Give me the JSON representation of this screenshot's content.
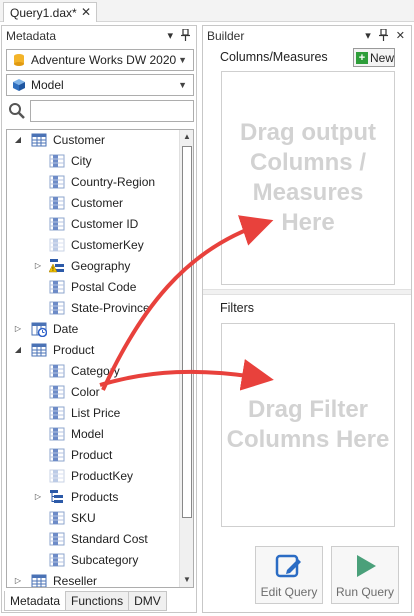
{
  "doc_tab": {
    "title": "Query1.dax*",
    "close": "✕"
  },
  "metadata": {
    "title": "Metadata",
    "pin": "▾",
    "pin2": "⊥",
    "model_source": "Adventure Works DW 2020",
    "perspective": "Model",
    "search_placeholder": "",
    "tree": [
      {
        "label": "Customer",
        "kind": "table",
        "expand": "◢",
        "level": 0
      },
      {
        "label": "City",
        "kind": "column",
        "level": 1
      },
      {
        "label": "Country-Region",
        "kind": "column",
        "level": 1
      },
      {
        "label": "Customer",
        "kind": "column",
        "level": 1
      },
      {
        "label": "Customer ID",
        "kind": "column",
        "level": 1
      },
      {
        "label": "CustomerKey",
        "kind": "column-hidden",
        "level": 1
      },
      {
        "label": "Geography",
        "kind": "hierarchy-warn",
        "expand": "▷",
        "level": 1
      },
      {
        "label": "Postal Code",
        "kind": "column",
        "level": 1
      },
      {
        "label": "State-Province",
        "kind": "column",
        "level": 1
      },
      {
        "label": "Date",
        "kind": "table-date",
        "expand": "▷",
        "level": 0
      },
      {
        "label": "Product",
        "kind": "table",
        "expand": "◢",
        "level": 0
      },
      {
        "label": "Category",
        "kind": "column",
        "level": 1
      },
      {
        "label": "Color",
        "kind": "column",
        "level": 1
      },
      {
        "label": "List Price",
        "kind": "column",
        "level": 1
      },
      {
        "label": "Model",
        "kind": "column",
        "level": 1
      },
      {
        "label": "Product",
        "kind": "column",
        "level": 1
      },
      {
        "label": "ProductKey",
        "kind": "column-hidden",
        "level": 1
      },
      {
        "label": "Products",
        "kind": "hierarchy",
        "expand": "▷",
        "level": 1
      },
      {
        "label": "SKU",
        "kind": "column",
        "level": 1
      },
      {
        "label": "Standard Cost",
        "kind": "column",
        "level": 1
      },
      {
        "label": "Subcategory",
        "kind": "column",
        "level": 1
      },
      {
        "label": "Reseller",
        "kind": "table",
        "expand": "▷",
        "level": 0
      }
    ],
    "tabs": [
      "Metadata",
      "Functions",
      "DMV"
    ]
  },
  "builder": {
    "title": "Builder",
    "columns_label": "Columns/Measures",
    "new_label": "New",
    "columns_drop_text": "Drag output Columns / Measures Here",
    "filters_label": "Filters",
    "filters_drop_text": "Drag Filter Columns Here",
    "edit_query_label": "Edit Query",
    "run_query_label": "Run Query"
  },
  "colors": {
    "arrow": "#e8413c",
    "table_icon": "#4a72b5",
    "new_plus": "#2e9e3a",
    "run_icon": "#4aa07a",
    "edit_icon": "#2b6cc4"
  }
}
